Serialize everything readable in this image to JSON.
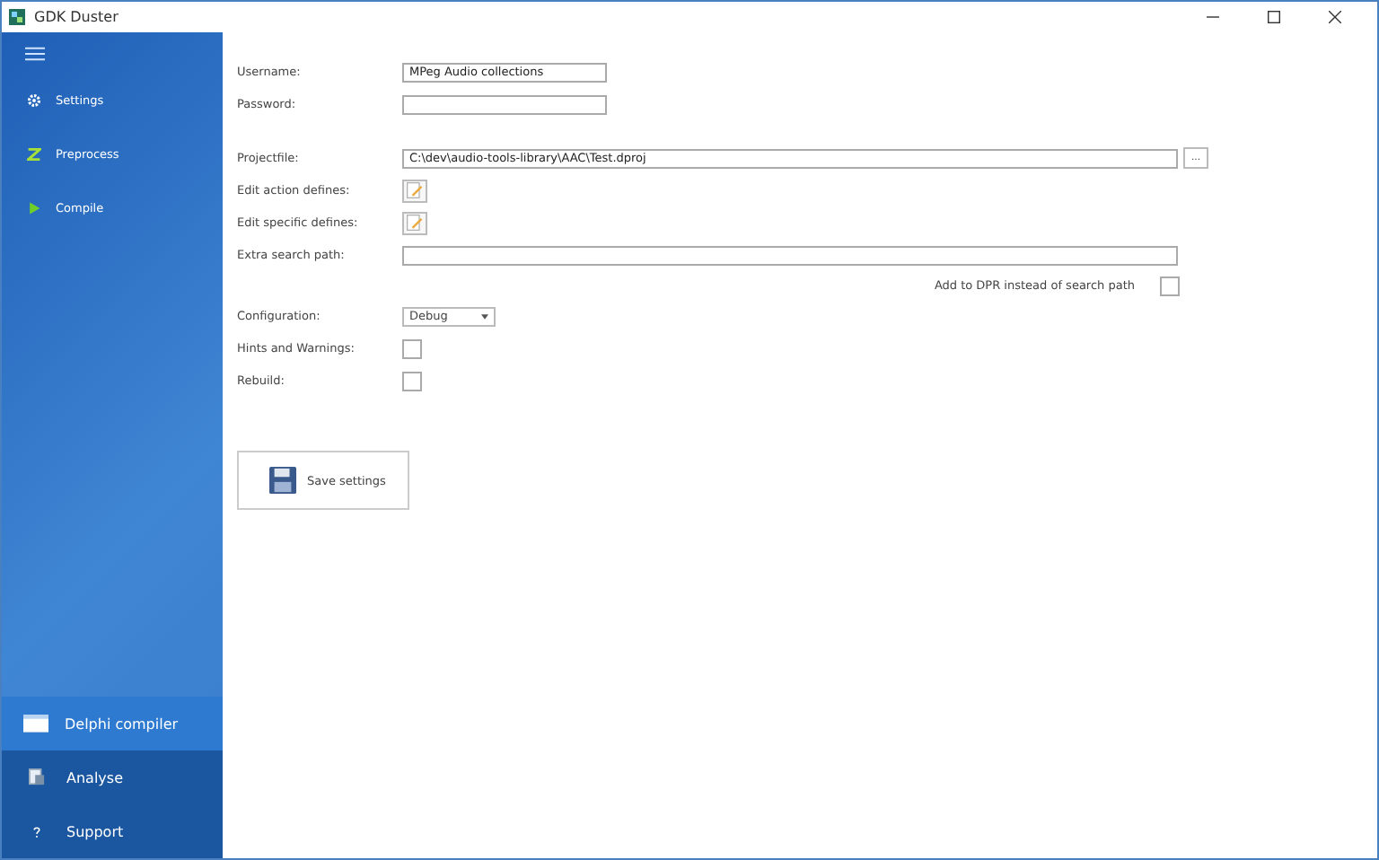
{
  "window": {
    "title": "GDK Duster"
  },
  "sidebar": {
    "items": [
      {
        "label": "Settings",
        "selected": false
      },
      {
        "label": "Preprocess",
        "selected": false
      },
      {
        "label": "Compile",
        "selected": false
      }
    ],
    "sections": [
      {
        "label": "Delphi compiler",
        "selected": true
      },
      {
        "label": "Analyse",
        "selected": false
      },
      {
        "label": "Support",
        "selected": false
      }
    ]
  },
  "form": {
    "rows": [
      {
        "kind": "text",
        "label": "Username:",
        "value": "MPeg Audio collections"
      },
      {
        "kind": "text",
        "label": "Password:",
        "value": ""
      },
      {
        "kind": "file",
        "label": "Projectfile:",
        "value": "C:\\dev\\audio-tools-library\\AAC\\Test.dproj",
        "browse": "..."
      },
      {
        "kind": "edit",
        "label": "Edit action defines:"
      },
      {
        "kind": "edit",
        "label": "Edit specific defines:"
      },
      {
        "kind": "path",
        "label": "Extra search path:",
        "value": ""
      },
      {
        "kind": "option",
        "label": "Add to DPR instead of search path",
        "checked": false
      },
      {
        "kind": "combo",
        "label": "Configuration:",
        "value": "Debug"
      },
      {
        "kind": "check",
        "label": "Hints and Warnings:",
        "checked": false
      },
      {
        "kind": "check",
        "label": "Rebuild:",
        "checked": false
      }
    ],
    "save_button": "Save settings"
  }
}
